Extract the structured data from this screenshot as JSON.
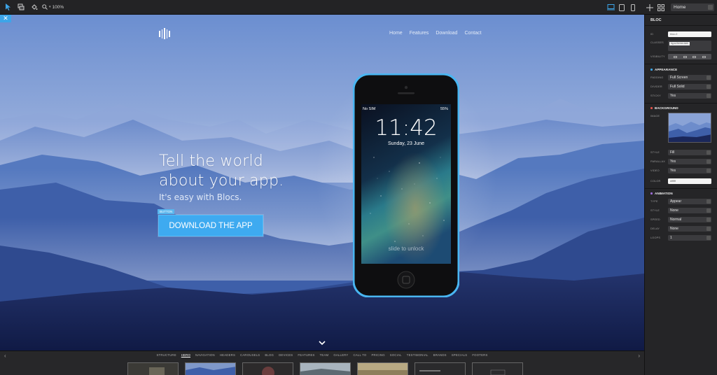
{
  "toolbar": {
    "zoom_label": "100%",
    "page_select": "Home"
  },
  "site": {
    "nav": [
      "Home",
      "Features",
      "Download",
      "Contact"
    ],
    "headline_line1": "Tell the world",
    "headline_line2": "about your app.",
    "subheadline": "It's easy with Blocs.",
    "button_tag": "BUTTON",
    "cta_label": "DOWNLOAD THE APP",
    "phone": {
      "carrier": "No SIM",
      "battery": "55%",
      "time": "11:42",
      "date": "Sunday, 23 June",
      "unlock": "slide to unlock"
    }
  },
  "inspector": {
    "title": "BLOC",
    "id_label": "ID",
    "id_value": "bloc-0",
    "classes_label": "CLASSES",
    "class_tag": "bg-w-theme-dark",
    "visibility_label": "VISIBILITY",
    "appearance": {
      "title": "APPEARANCE",
      "color": "#3da5e8",
      "rows": [
        {
          "label": "PADDING",
          "value": "Full Screen"
        },
        {
          "label": "DIVIDER",
          "value": "Full Solid"
        },
        {
          "label": "STICKY",
          "value": "Yes"
        }
      ]
    },
    "background": {
      "title": "BACKGROUND",
      "color": "#e0524a",
      "image_label": "IMAGE",
      "rows": [
        {
          "label": "STYLE",
          "value": "Fill"
        },
        {
          "label": "PARALLAX",
          "value": "Yes"
        },
        {
          "label": "VIDEO",
          "value": "Yes"
        }
      ],
      "color_label": "COLOR",
      "color_value": "#ffffff"
    },
    "animation": {
      "title": "ANIMATION",
      "color": "#9b6bd6",
      "rows": [
        {
          "label": "TYPE",
          "value": "Appear"
        },
        {
          "label": "STYLE",
          "value": "None"
        },
        {
          "label": "SPEED",
          "value": "Normal"
        },
        {
          "label": "DELAY",
          "value": "None"
        },
        {
          "label": "LOOPS",
          "value": "1"
        }
      ]
    }
  },
  "library": {
    "tabs": [
      "STRUCTURE",
      "HERO",
      "NAVIGATION",
      "HEADERS",
      "CAROUSELS",
      "BLOG",
      "DEVICES",
      "FEATURES",
      "TEAM",
      "GALLERY",
      "CALL TO",
      "PRICING",
      "SOCIAL",
      "TESTIMONIAL",
      "BRANDS",
      "SPECIALS",
      "FOOTERS"
    ],
    "active_tab": "HERO"
  }
}
